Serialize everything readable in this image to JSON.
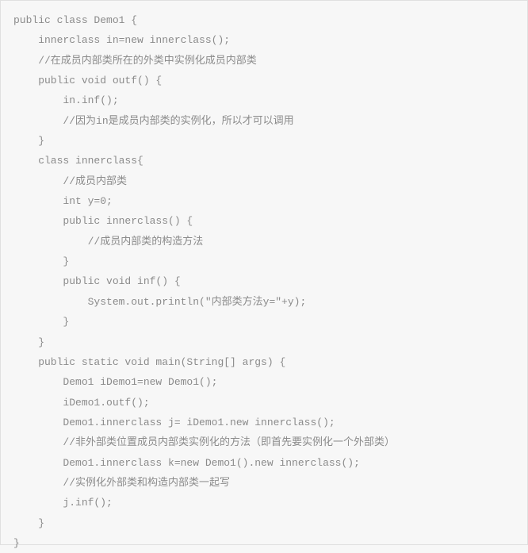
{
  "code": {
    "lines": [
      "public class Demo1 {",
      "    innerclass in=new innerclass();",
      "    //在成员内部类所在的外类中实例化成员内部类",
      "    public void outf() {",
      "        in.inf();",
      "        //因为in是成员内部类的实例化，所以才可以调用",
      "    }",
      "    class innerclass{",
      "        //成员内部类",
      "        int y=0;",
      "        public innerclass() {",
      "            //成员内部类的构造方法",
      "        }",
      "        public void inf() {",
      "            System.out.println(\"内部类方法y=\"+y);",
      "        }",
      "    }",
      "    public static void main(String[] args) {",
      "        Demo1 iDemo1=new Demo1();",
      "        iDemo1.outf();",
      "        Demo1.innerclass j= iDemo1.new innerclass();",
      "        //非外部类位置成员内部类实例化的方法（即首先要实例化一个外部类）",
      "        Demo1.innerclass k=new Demo1().new innerclass();",
      "        //实例化外部类和构造内部类一起写",
      "        j.inf();",
      "    }",
      "}"
    ]
  }
}
